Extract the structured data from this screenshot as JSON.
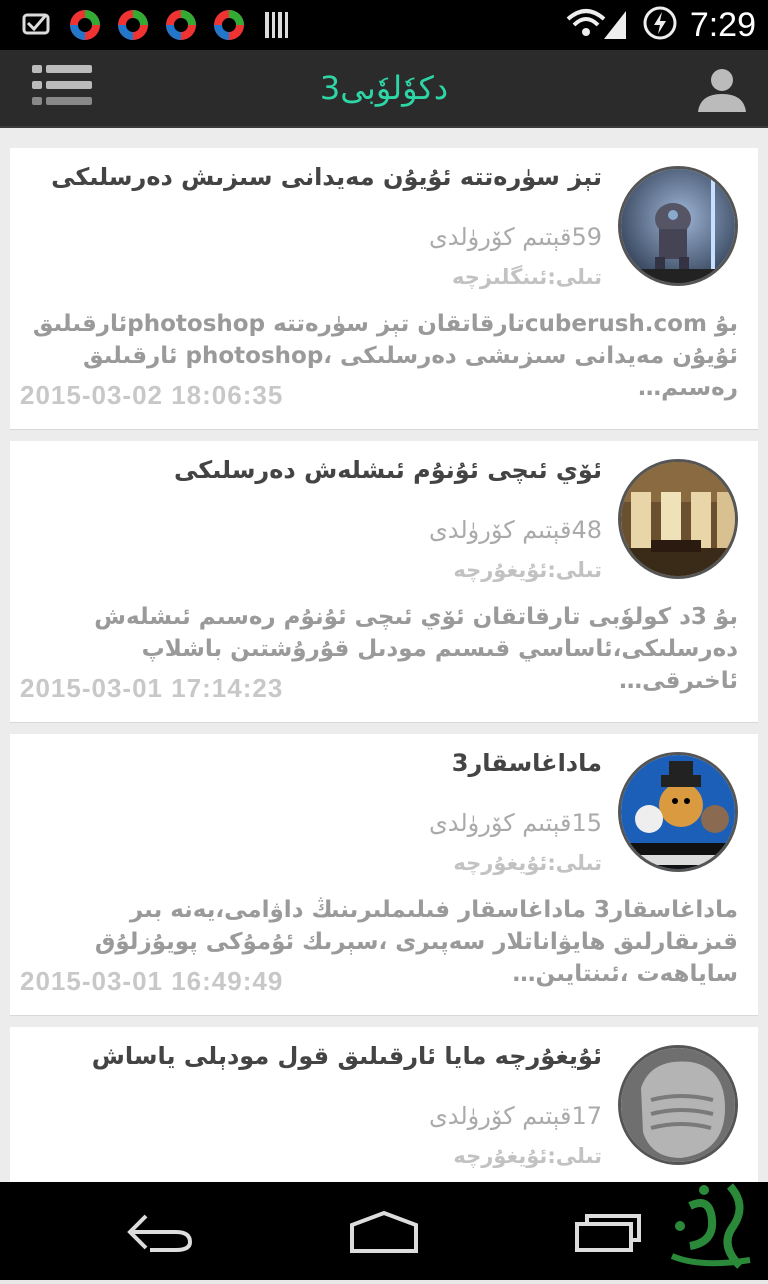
{
  "status": {
    "time": "7:29"
  },
  "app": {
    "title": "3دكوٗلوٗبى"
  },
  "items": [
    {
      "title": "تېز سۈرەتتە ئۇيۇن مەيدانى سىزىش دەرسلىكى",
      "views": "59قېتىم كۆرۈلدى",
      "language": "تىلى:ئىنگلىزچە",
      "description": "بۇ cuberush.comتارقاتقان تېز سۈرەتتە photoshopئارقىلىق ئۇيۇن مەيدانى سىزىشى دەرسلىكى ،photoshop ئارقىلىق رەسىم…",
      "date": "2015-03-02 18:06:35",
      "thumb": "robot-scene-thumbnail"
    },
    {
      "title": "ئۆي ئىچى ئۇنۇم ئىشلەش دەرسلىكى",
      "views": "48قېتىم كۆرۈلدى",
      "language": "تىلى:ئۇيغۇرچە",
      "description": "بۇ 3د كولوٗبى تارقاتقان ئۆي ئىچى ئۇنۇم رەسىم ئىشلەش دەرسلىكى،ئاساسي قىسىم مودىل قۇرۇشتىن باشلاپ ئاخىرقى…",
      "date": "2015-03-01 17:14:23",
      "thumb": "interior-room-thumbnail"
    },
    {
      "title": "ماداغاسقار3",
      "views": "15قېتىم كۆرۈلدى",
      "language": "تىلى:ئۇيغۇرچە",
      "description": "ماداغاسقار3 ماداغاسقار فىلىملىرىنىڭ داۋامى،يەنە بىر قىزىقارلىق ھايۋاناتلار سەپىرى ،سېرىك ئۇمۇكى پويۇزلۇق ساياھەت ،ئىنتايىن…",
      "date": "2015-03-01 16:49:49",
      "thumb": "madagascar-poster-thumbnail"
    },
    {
      "title": "ئۇيغۇرچە مايا ئارقىلىق قول مودېلى ياساش",
      "views": "17قېتىم كۆرۈلدى",
      "language": "تىلى:ئۇيغۇرچە",
      "description": "",
      "date": "",
      "thumb": "hand-model-thumbnail"
    }
  ],
  "colors": {
    "accent": "#2ed6a6",
    "appbar": "#2b2b2b",
    "statusbar": "#000000"
  },
  "icons": [
    "notification-icon",
    "app-icon",
    "signal-icon",
    "battery-icon",
    "menu-icon",
    "user-icon",
    "back-icon",
    "home-icon",
    "recents-icon",
    "watermark-logo"
  ]
}
